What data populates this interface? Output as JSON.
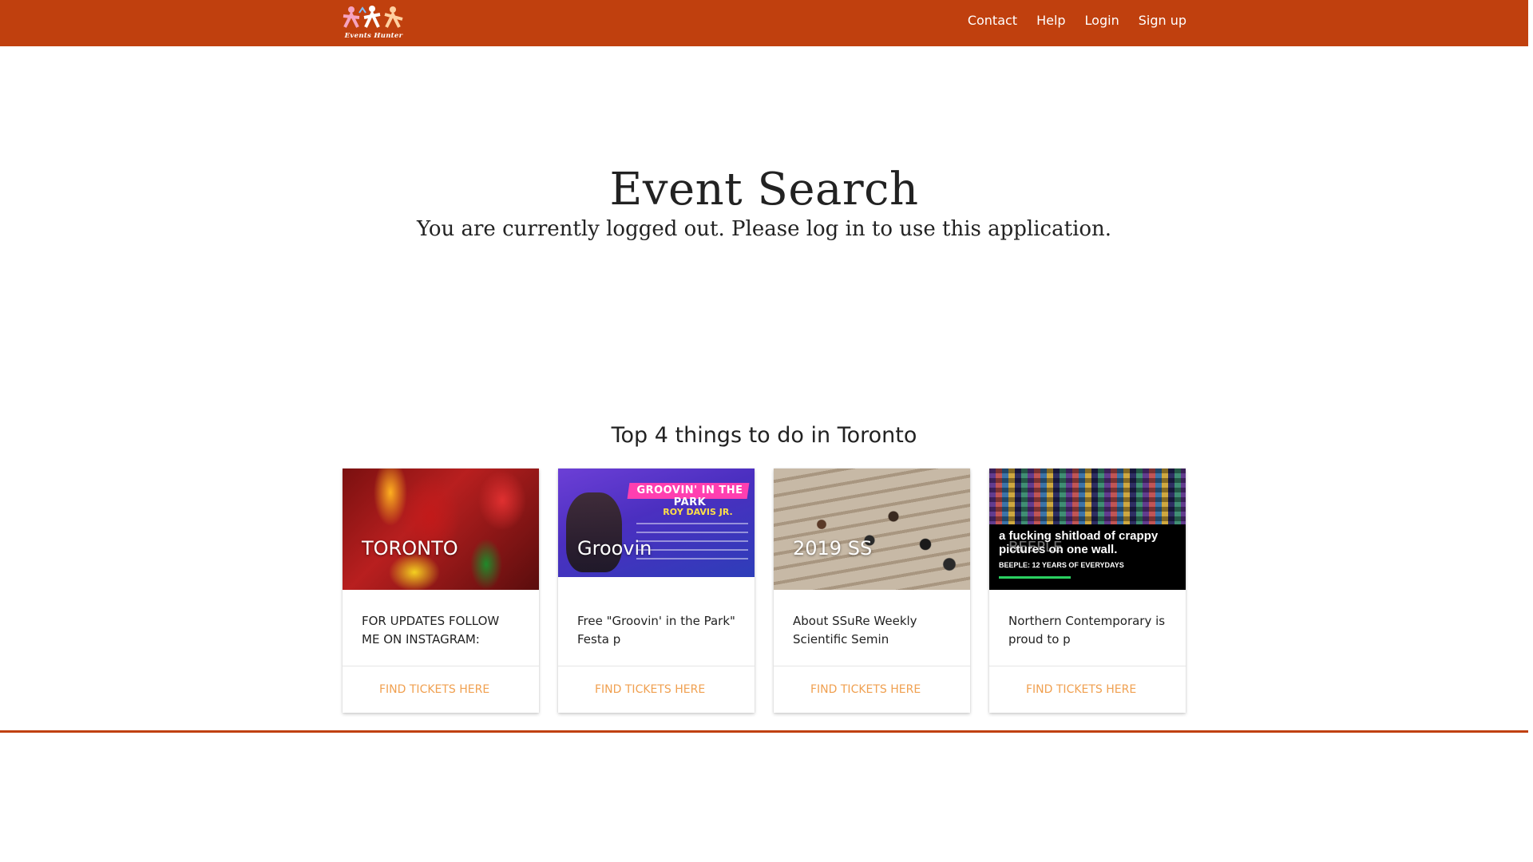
{
  "navbar": {
    "logo_text": "Events Hunter",
    "links": [
      {
        "label": "Contact"
      },
      {
        "label": "Help"
      },
      {
        "label": "Login"
      },
      {
        "label": "Sign up"
      }
    ],
    "color": "#c0400e"
  },
  "hero": {
    "title": "Event Search",
    "subtitle": "You are currently logged out. Please log in to use this application."
  },
  "top": {
    "heading": "Top 4 things to do in Toronto",
    "cards": [
      {
        "image_title": "TORONTO",
        "description": "FOR UPDATES FOLLOW ME ON INSTAGRAM:",
        "action": "FIND TICKETS HERE"
      },
      {
        "image_title": "Groovin",
        "image_banner": "GROOVIN' IN THE PARK",
        "image_name": "ROY DAVIS JR.",
        "description": "Free \"Groovin' in the Park\" Festa p",
        "action": "FIND TICKETS HERE"
      },
      {
        "image_title": "2019 SS",
        "description": "About SSuRe Weekly Scientific Semin",
        "action": "FIND TICKETS HERE"
      },
      {
        "image_title": "BEEPLE",
        "image_text": "a fucking shitload of crappy pictures on one wall.",
        "image_sub": "BEEPLE: 12 YEARS OF EVERYDAYS",
        "description": "Northern Contemporary is proud to p",
        "action": "FIND TICKETS HERE"
      }
    ]
  },
  "colors": {
    "accent": "#c0400e",
    "link": "#f0a050"
  }
}
